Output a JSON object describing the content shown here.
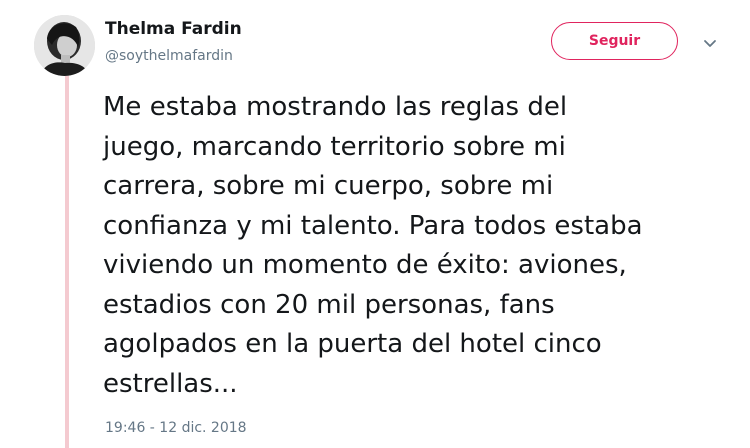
{
  "tweet": {
    "author": {
      "display_name": "Thelma Fardin",
      "handle": "@soythelmafardin",
      "avatar_icon": "profile-photo"
    },
    "follow_button_label": "Seguir",
    "menu_icon": "chevron-down-icon",
    "text_lines": [
      "Me estaba mostrando las reglas del",
      "juego, marcando territorio sobre mi",
      "carrera, sobre mi cuerpo, sobre mi",
      "confianza y mi talento. Para todos estaba",
      "viviendo un momento de éxito: aviones,",
      "estadios con 20 mil personas, fans",
      "agolpados en la puerta del hotel cinco",
      "estrellas..."
    ],
    "timestamp": "19:46 - 12 dic. 2018"
  },
  "colors": {
    "accent": "#e0245e",
    "thread_line": "#f4cad0",
    "secondary_text": "#657786",
    "primary_text": "#14171a"
  }
}
